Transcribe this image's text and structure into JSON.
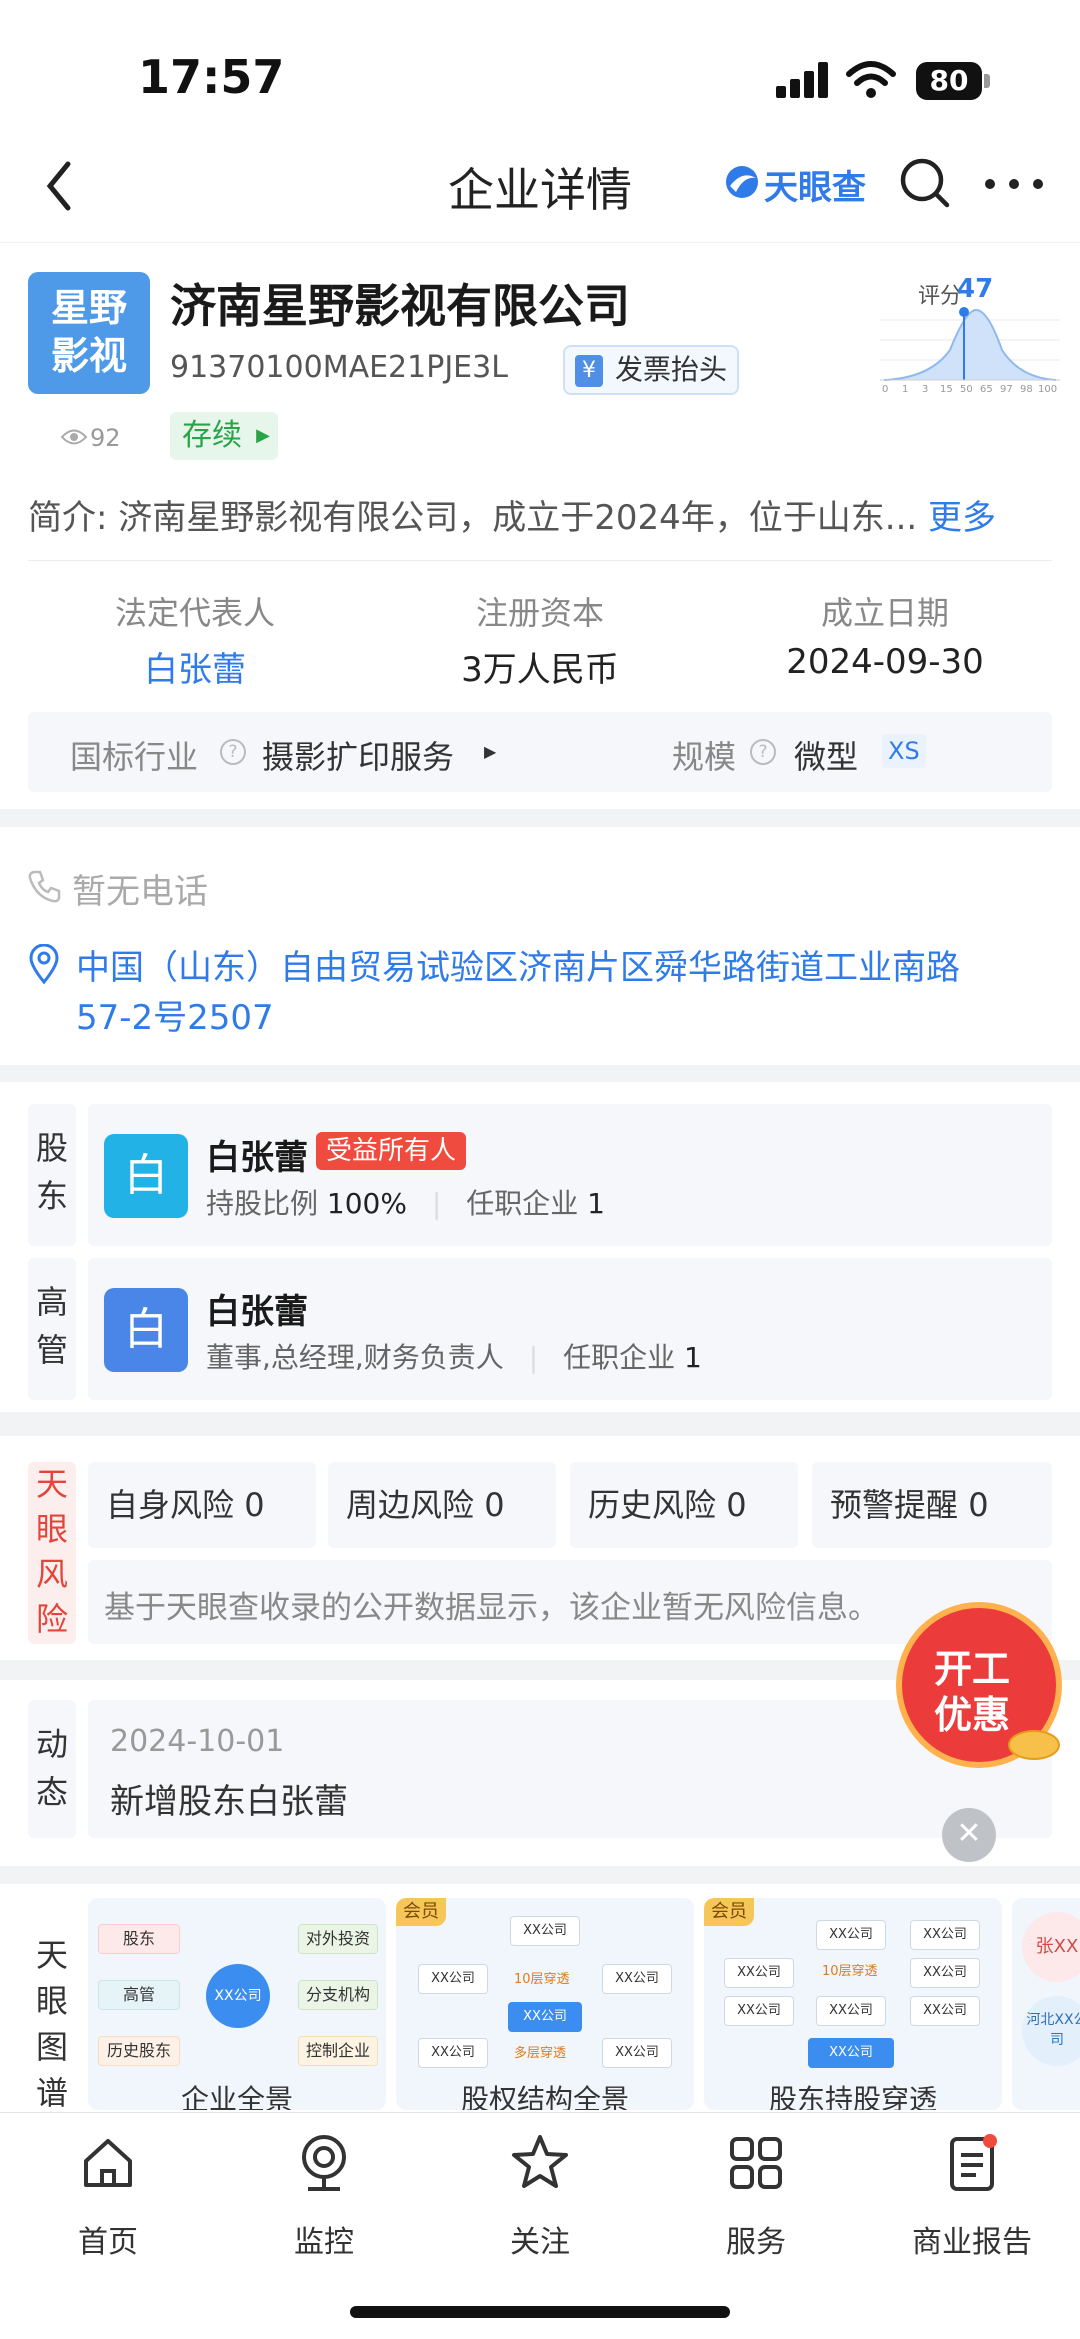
{
  "status_bar": {
    "time": "17:57",
    "battery": "80"
  },
  "nav": {
    "title": "企业详情",
    "brand": "天眼查"
  },
  "company": {
    "logo_text": "星野影视",
    "name": "济南星野影视有限公司",
    "credit_code": "91370100MAE21PJE3L",
    "invoice_label": "发票抬头",
    "views": "92",
    "status": "存续",
    "score_label": "评分",
    "score": "47",
    "score_ticks": [
      "0",
      "1",
      "3",
      "15",
      "50",
      "65",
      "97",
      "98",
      "100"
    ],
    "intro_label": "简介:",
    "intro_text": "济南星野影视有限公司，成立于2024年，位于山东...",
    "intro_more": "更多"
  },
  "key_info": [
    {
      "label": "法定代表人",
      "value": "白张蕾"
    },
    {
      "label": "注册资本",
      "value": "3万人民币"
    },
    {
      "label": "成立日期",
      "value": "2024-09-30"
    }
  ],
  "industry": {
    "label": "国标行业",
    "value": "摄影扩印服务",
    "scale_label": "规模",
    "scale_value": "微型",
    "scale_tag": "XS"
  },
  "contact": {
    "phone": "暂无电话",
    "address_line1": "中国（山东）自由贸易试验区济南片区舜华路街道工业南路",
    "address_line2": "57-2号2507"
  },
  "shareholder": {
    "section": "股东",
    "avatar": "白",
    "name": "白张蕾",
    "badge": "受益所有人",
    "ratio_label": "持股比例",
    "ratio": "100%",
    "jobs_label": "任职企业",
    "jobs": "1"
  },
  "executive": {
    "section": "高管",
    "avatar": "白",
    "name": "白张蕾",
    "roles": "董事,总经理,财务负责人",
    "jobs_label": "任职企业",
    "jobs": "1"
  },
  "risk": {
    "section": "天眼风险",
    "items": [
      {
        "label": "自身风险",
        "count": "0"
      },
      {
        "label": "周边风险",
        "count": "0"
      },
      {
        "label": "历史风险",
        "count": "0"
      },
      {
        "label": "预警提醒",
        "count": "0"
      }
    ],
    "note": "基于天眼查收录的公开数据显示，该企业暂无风险信息。"
  },
  "promo": {
    "line1": "开工",
    "line2": "优惠"
  },
  "news": {
    "section": "动态",
    "date": "2024-10-01",
    "text": "新增股东白张蕾"
  },
  "graph": {
    "section": "天眼图谱",
    "vip_label": "会员",
    "card1": {
      "center": "XX公司",
      "left": [
        "股东",
        "高管",
        "历史股东"
      ],
      "right": [
        "对外投资",
        "分支机构",
        "控制企业"
      ],
      "caption": "企业全景"
    },
    "card2": {
      "node": "XX公司",
      "through1": "10层穿透",
      "through2": "多层穿透",
      "caption": "股权结构全景"
    },
    "card3": {
      "node": "XX公司",
      "through": "10层穿透",
      "caption": "股东持股穿透"
    },
    "card4": {
      "top": "张XX",
      "bottom": "河北XX公司"
    }
  },
  "tabbar": [
    {
      "label": "首页",
      "icon": "home-icon"
    },
    {
      "label": "监控",
      "icon": "monitor-icon"
    },
    {
      "label": "关注",
      "icon": "star-icon"
    },
    {
      "label": "服务",
      "icon": "grid-icon"
    },
    {
      "label": "商业报告",
      "icon": "report-icon"
    }
  ],
  "colors": {
    "accent": "#2f7be9",
    "status_green": "#29a348",
    "danger": "#f04b3f",
    "logo_blue": "#4f9ae8"
  }
}
